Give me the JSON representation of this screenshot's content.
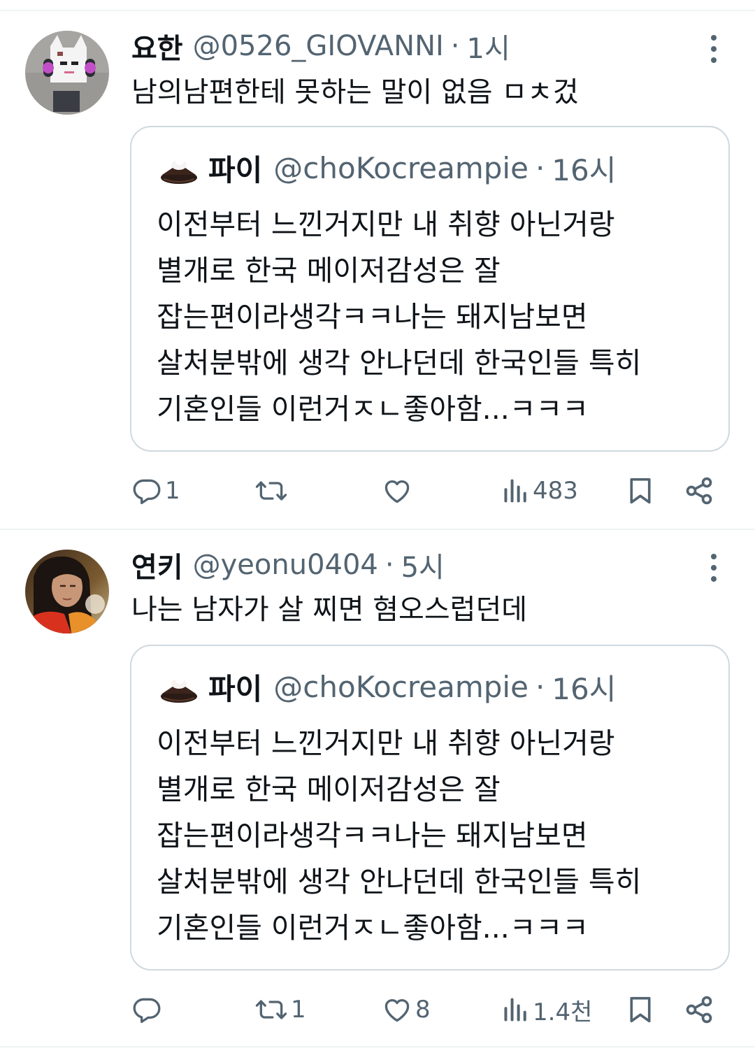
{
  "tweets": [
    {
      "display_name": "요한",
      "handle": "@0526_GIOVANNI",
      "separator": "·",
      "time": "1시",
      "text": "남의남편한테 못하는 말이 없음 ㅁㅊ겄",
      "quote": {
        "display_name": "파이",
        "handle": "@choKocreampie",
        "separator": "·",
        "time": "16시",
        "lines": [
          "이전부터 느낀거지만 내 취향 아닌거랑",
          "별개로 한국 메이저감성은 잘",
          "잡는편이라생각ㅋㅋ나는 돼지남보면",
          "살처분밖에 생각 안나던데 한국인들 특히",
          "기혼인들 이런거ㅈㄴ좋아함...ㅋㅋㅋ"
        ]
      },
      "actions": {
        "replies": "1",
        "retweets": "",
        "likes": "",
        "views": "483"
      }
    },
    {
      "display_name": "연키",
      "handle": "@yeonu0404",
      "separator": "·",
      "time": "5시",
      "text": "나는 남자가 살 찌면 혐오스럽던데",
      "quote": {
        "display_name": "파이",
        "handle": "@choKocreampie",
        "separator": "·",
        "time": "16시",
        "lines": [
          "이전부터 느낀거지만 내 취향 아닌거랑",
          "별개로 한국 메이저감성은 잘",
          "잡는편이라생각ㅋㅋ나는 돼지남보면",
          "살처분밖에 생각 안나던데 한국인들 특히",
          "기혼인들 이런거ㅈㄴ좋아함...ㅋㅋㅋ"
        ]
      },
      "actions": {
        "replies": "",
        "retweets": "1",
        "likes": "8",
        "views": "1.4천"
      }
    }
  ],
  "colors": {
    "text": "#0f1419",
    "secondary": "#536471",
    "border": "#cfd9de",
    "divider": "#eff3f4"
  },
  "icons": [
    "more-vertical-icon",
    "reply-icon",
    "retweet-icon",
    "like-icon",
    "views-icon",
    "bookmark-icon",
    "share-icon"
  ]
}
